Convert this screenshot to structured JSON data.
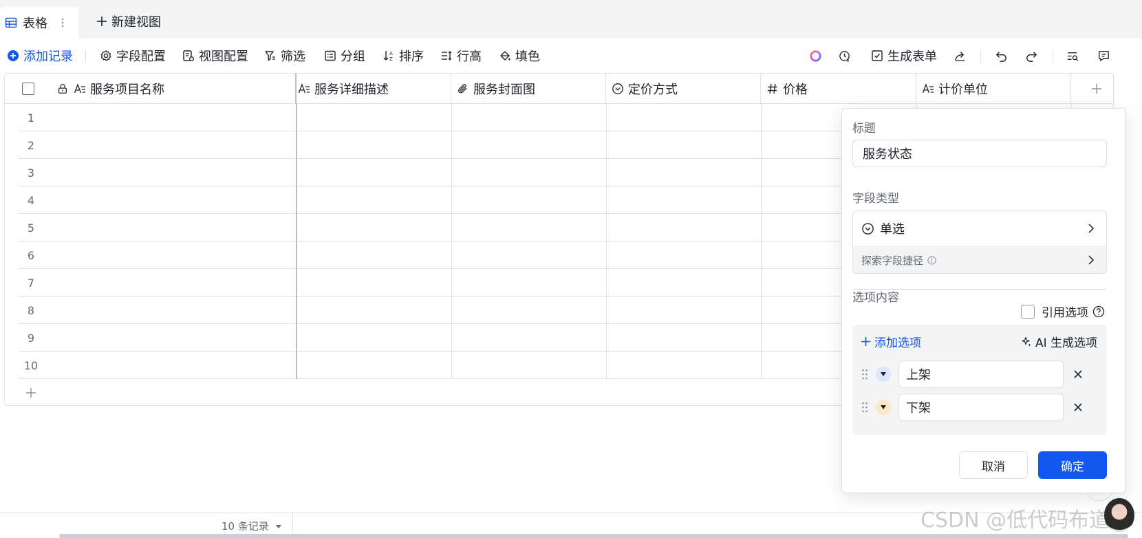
{
  "tabs": {
    "active_label": "表格",
    "new_view_label": "新建视图"
  },
  "toolbar": {
    "add_record": "添加记录",
    "field_config": "字段配置",
    "view_config": "视图配置",
    "filter": "筛选",
    "group": "分组",
    "sort": "排序",
    "row_height": "行高",
    "fill": "填色",
    "generate_form": "生成表单"
  },
  "grid": {
    "columns": [
      {
        "label": "服务项目名称",
        "icon": "text-icon"
      },
      {
        "label": "服务详细描述",
        "icon": "text-icon"
      },
      {
        "label": "服务封面图",
        "icon": "attachment-icon"
      },
      {
        "label": "定价方式",
        "icon": "single-select-icon"
      },
      {
        "label": "价格",
        "icon": "number-icon"
      },
      {
        "label": "计价单位",
        "icon": "text-icon"
      }
    ],
    "row_numbers": [
      "1",
      "2",
      "3",
      "4",
      "5",
      "6",
      "7",
      "8",
      "9",
      "10"
    ]
  },
  "footer": {
    "record_count": "10 条记录",
    "watermark": "CSDN @低代码布道师"
  },
  "panel": {
    "title_label": "标题",
    "title_value": "服务状态",
    "field_type_label": "字段类型",
    "field_type_value": "单选",
    "shortcut_label": "探索字段捷径",
    "options_label": "选项内容",
    "cite_label": "引用选项",
    "add_option_label": "添加选项",
    "ai_generate_label": "AI 生成选项",
    "options": [
      {
        "label": "上架",
        "color": "#dde5ff",
        "arrow": "#1f2329"
      },
      {
        "label": "下架",
        "color": "#fde7c9",
        "arrow": "#1f2329"
      }
    ],
    "cancel_label": "取消",
    "confirm_label": "确定"
  },
  "colors": {
    "accent": "#1456f0",
    "border": "#dee0e3",
    "text_secondary": "#646a73"
  }
}
